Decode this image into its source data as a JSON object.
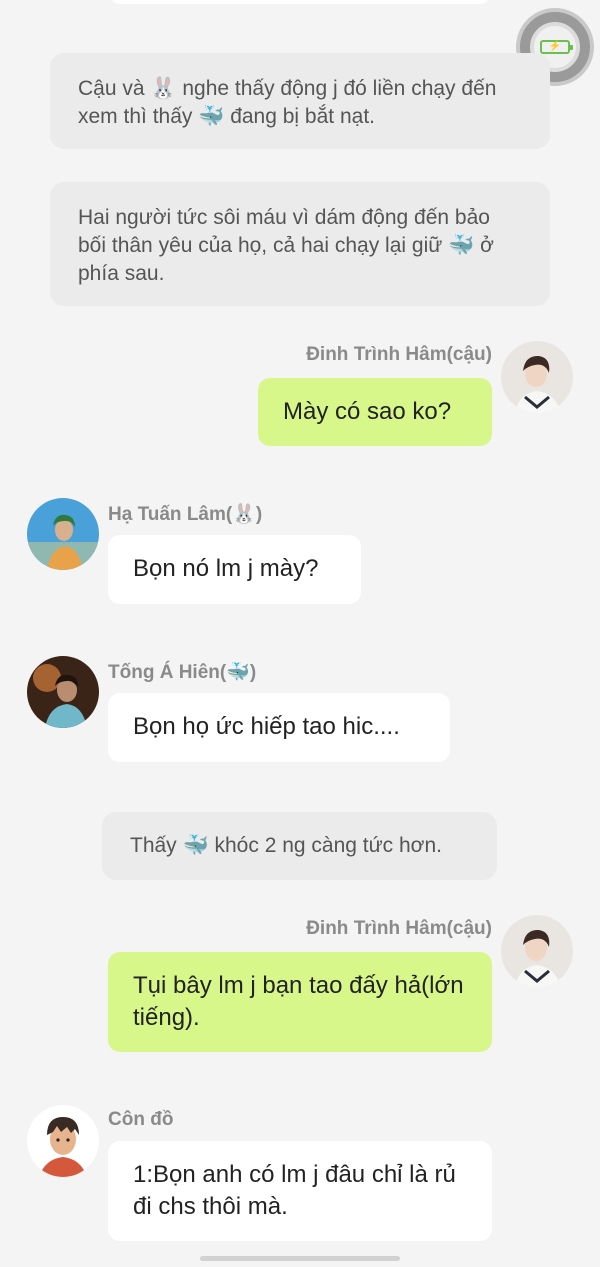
{
  "narration": [
    {
      "text": "Cậu và 🐰 nghe thấy động j đó liền chạy đến xem thì thấy 🐳 đang bị bắt nạt."
    },
    {
      "text": "Hai người tức sôi máu vì dám động đến bảo bối thân yêu của họ, cả hai chạy lại giữ 🐳 ở phía sau."
    },
    {
      "text": "Thấy 🐳 khóc 2 ng càng tức hơn."
    }
  ],
  "messages": [
    {
      "sender": "Đinh Trình Hâm(cậu)",
      "text": "Mày có sao ko?"
    },
    {
      "sender": "Hạ Tuấn Lâm(🐰)",
      "text": "Bọn nó lm j mày?"
    },
    {
      "sender": "Tống Á Hiên(🐳)",
      "text": "Bọn họ ức hiếp tao hic...."
    },
    {
      "sender": "Đinh Trình Hâm(cậu)",
      "text": "Tụi bây lm j bạn tao đấy hả(lớn tiếng)."
    },
    {
      "sender": "Côn đồ",
      "text": "1:Bọn anh có lm j đâu chỉ là rủ đi chs thôi mà."
    }
  ],
  "icons": {
    "floating_ball": "battery-charging-icon"
  },
  "colors": {
    "background": "#f4f4f4",
    "narration_bubble": "#ebebeb",
    "sent_bubble": "#d8f78b",
    "received_bubble": "#ffffff",
    "sender_name": "#8a8a8a"
  }
}
